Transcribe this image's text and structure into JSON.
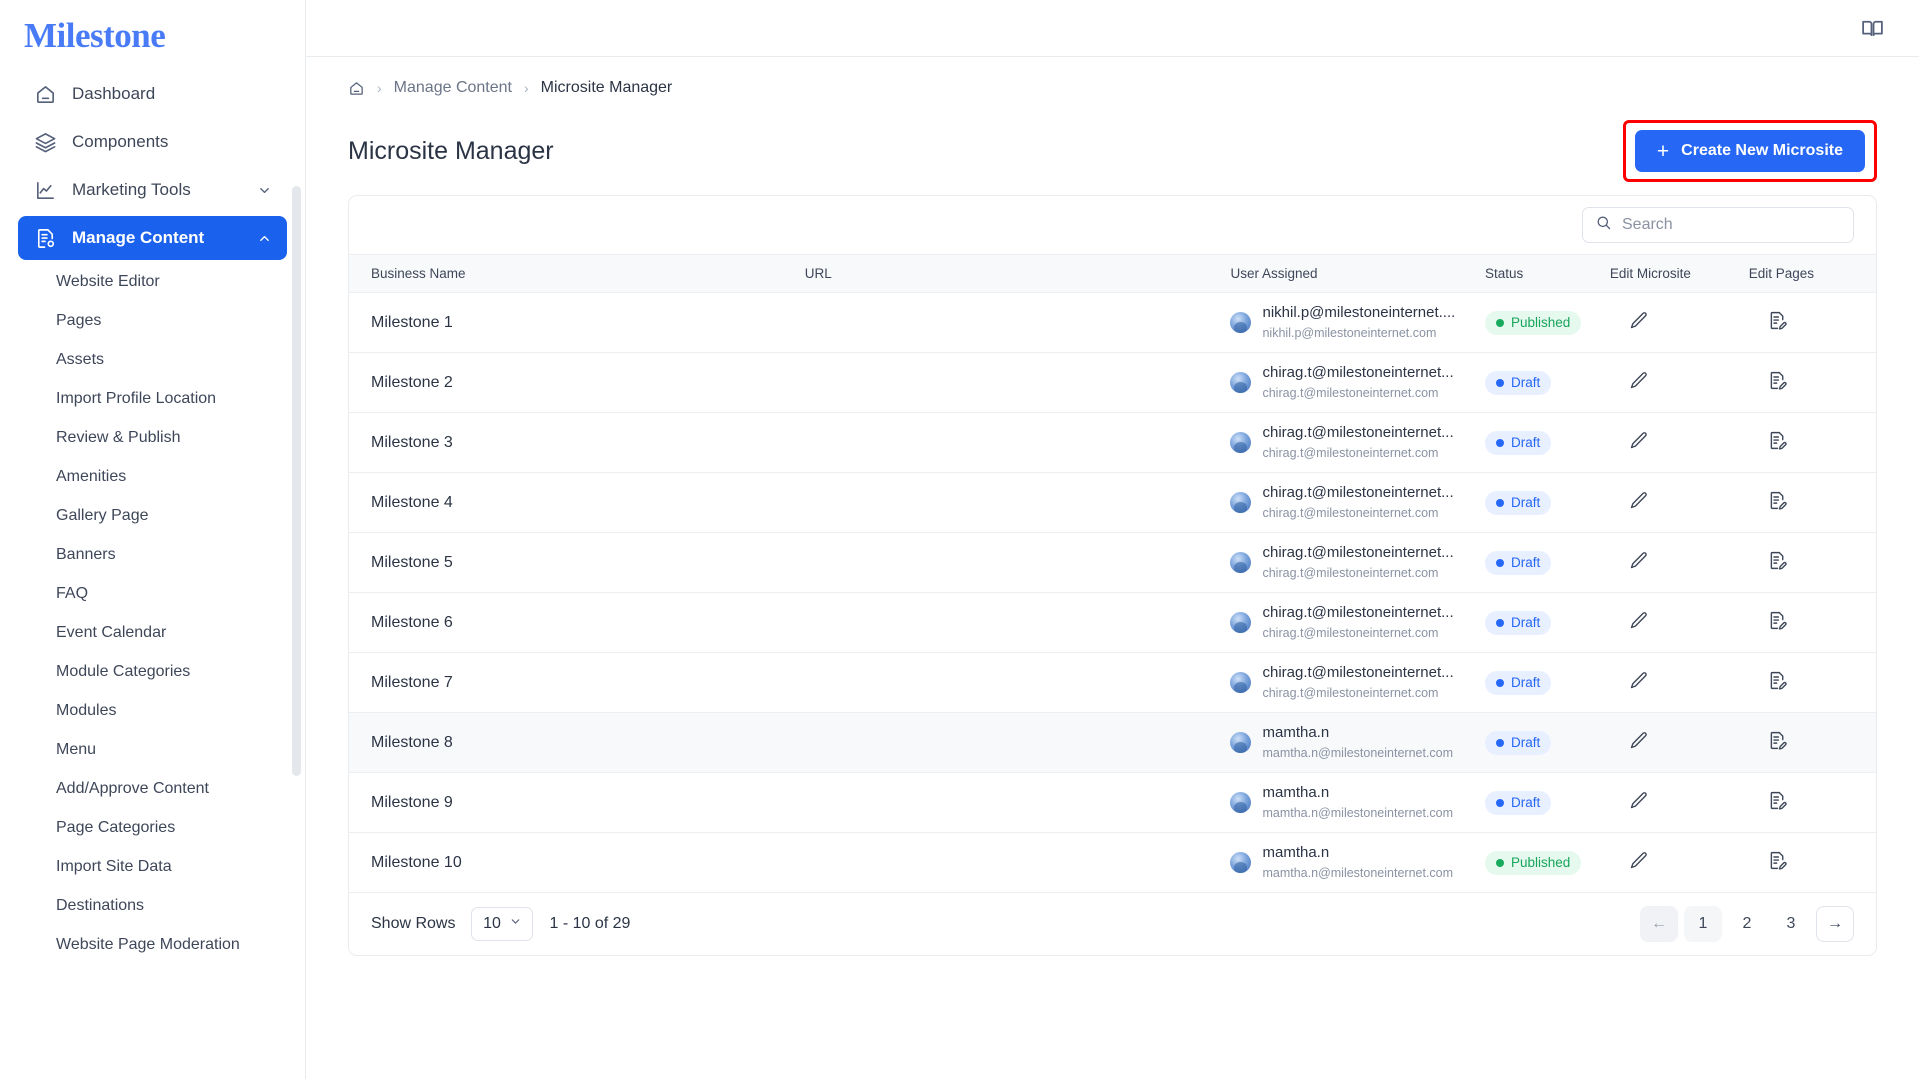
{
  "brand": {
    "logo_text": "Milestone",
    "logo_color": "#4a7bf7"
  },
  "sidebar": {
    "nav": [
      {
        "label": "Dashboard",
        "icon": "home-icon",
        "active": false,
        "expandable": false
      },
      {
        "label": "Components",
        "icon": "layers-icon",
        "active": false,
        "expandable": false
      },
      {
        "label": "Marketing Tools",
        "icon": "chart-line-icon",
        "active": false,
        "expandable": true,
        "expanded": false
      },
      {
        "label": "Manage Content",
        "icon": "content-settings-icon",
        "active": true,
        "expandable": true,
        "expanded": true
      }
    ],
    "sub_items": [
      {
        "label": "Website Editor"
      },
      {
        "label": "Pages"
      },
      {
        "label": "Assets"
      },
      {
        "label": "Import Profile Location"
      },
      {
        "label": "Review & Publish"
      },
      {
        "label": "Amenities"
      },
      {
        "label": "Gallery Page"
      },
      {
        "label": "Banners"
      },
      {
        "label": "FAQ"
      },
      {
        "label": "Event Calendar"
      },
      {
        "label": "Module Categories"
      },
      {
        "label": "Modules"
      },
      {
        "label": "Menu"
      },
      {
        "label": "Add/Approve Content"
      },
      {
        "label": "Page Categories"
      },
      {
        "label": "Import Site Data"
      },
      {
        "label": "Destinations"
      },
      {
        "label": "Website Page Moderation"
      }
    ]
  },
  "topbar": {
    "book_icon": "open-book-icon"
  },
  "breadcrumb": {
    "home_icon": "home-icon",
    "items": [
      {
        "label": "Manage Content"
      },
      {
        "label": "Microsite Manager"
      }
    ]
  },
  "page": {
    "title": "Microsite Manager",
    "create_button": {
      "label": "Create New Microsite",
      "plus": "+",
      "highlight_color": "#fe0000",
      "bg_color": "#2667f5"
    }
  },
  "search": {
    "placeholder": "Search",
    "value": "",
    "icon": "search-icon"
  },
  "table": {
    "columns": [
      "Business Name",
      "URL",
      "User Assigned",
      "Status",
      "Edit Microsite",
      "Edit Pages"
    ],
    "rows": [
      {
        "name": "Milestone 1",
        "url": "",
        "user_name": "nikhil.p@milestoneinternet....",
        "user_email": "nikhil.p@milestoneinternet.com",
        "status": "Published",
        "status_kind": "published",
        "hover": false
      },
      {
        "name": "Milestone 2",
        "url": "",
        "user_name": "chirag.t@milestoneinternet...",
        "user_email": "chirag.t@milestoneinternet.com",
        "status": "Draft",
        "status_kind": "draft",
        "hover": false
      },
      {
        "name": "Milestone 3",
        "url": "",
        "user_name": "chirag.t@milestoneinternet...",
        "user_email": "chirag.t@milestoneinternet.com",
        "status": "Draft",
        "status_kind": "draft",
        "hover": false
      },
      {
        "name": "Milestone 4",
        "url": "",
        "user_name": "chirag.t@milestoneinternet...",
        "user_email": "chirag.t@milestoneinternet.com",
        "status": "Draft",
        "status_kind": "draft",
        "hover": false
      },
      {
        "name": "Milestone 5",
        "url": "",
        "user_name": "chirag.t@milestoneinternet...",
        "user_email": "chirag.t@milestoneinternet.com",
        "status": "Draft",
        "status_kind": "draft",
        "hover": false
      },
      {
        "name": "Milestone 6",
        "url": "",
        "user_name": "chirag.t@milestoneinternet...",
        "user_email": "chirag.t@milestoneinternet.com",
        "status": "Draft",
        "status_kind": "draft",
        "hover": false
      },
      {
        "name": "Milestone 7",
        "url": "",
        "user_name": "chirag.t@milestoneinternet...",
        "user_email": "chirag.t@milestoneinternet.com",
        "status": "Draft",
        "status_kind": "draft",
        "hover": false
      },
      {
        "name": "Milestone 8",
        "url": "",
        "user_name": "mamtha.n",
        "user_email": "mamtha.n@milestoneinternet.com",
        "status": "Draft",
        "status_kind": "draft",
        "hover": true
      },
      {
        "name": "Milestone 9",
        "url": "",
        "user_name": "mamtha.n",
        "user_email": "mamtha.n@milestoneinternet.com",
        "status": "Draft",
        "status_kind": "draft",
        "hover": false
      },
      {
        "name": "Milestone 10",
        "url": "",
        "user_name": "mamtha.n",
        "user_email": "mamtha.n@milestoneinternet.com",
        "status": "Published",
        "status_kind": "published",
        "hover": false
      }
    ],
    "row_actions": {
      "edit_microsite_icon": "pencil-icon",
      "edit_pages_icon": "document-edit-icon"
    }
  },
  "pagination": {
    "show_rows_label": "Show Rows",
    "rows_per_page": "10",
    "range_text": "1 - 10 of 29",
    "prev_label": "←",
    "next_label": "→",
    "pages": [
      "1",
      "2",
      "3"
    ],
    "active_page": "1"
  }
}
